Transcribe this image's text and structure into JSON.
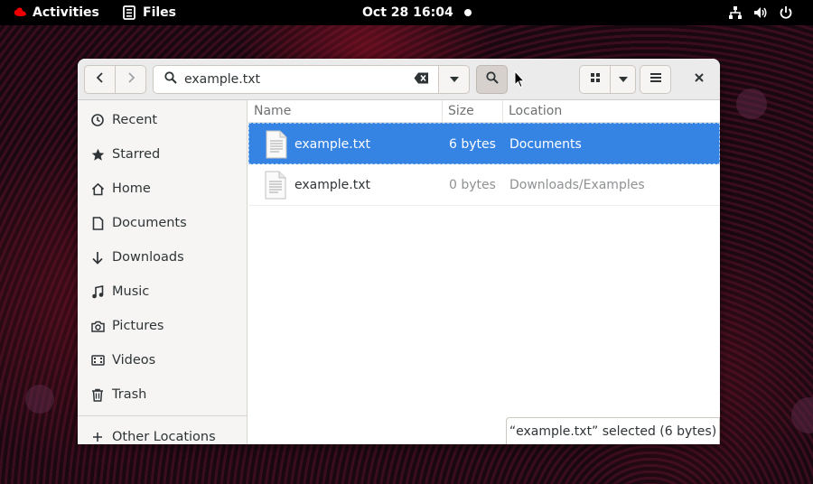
{
  "topbar": {
    "activities": "Activities",
    "app_name": "Files",
    "datetime": "Oct 28  16:04"
  },
  "headerbar": {
    "search_value": "example.txt"
  },
  "sidebar": {
    "items": [
      {
        "label": "Recent",
        "icon": "clock-icon"
      },
      {
        "label": "Starred",
        "icon": "star-icon"
      },
      {
        "label": "Home",
        "icon": "home-icon"
      },
      {
        "label": "Documents",
        "icon": "document-icon"
      },
      {
        "label": "Downloads",
        "icon": "download-icon"
      },
      {
        "label": "Music",
        "icon": "music-icon"
      },
      {
        "label": "Pictures",
        "icon": "camera-icon"
      },
      {
        "label": "Videos",
        "icon": "video-icon"
      },
      {
        "label": "Trash",
        "icon": "trash-icon"
      }
    ],
    "other_locations": "Other Locations"
  },
  "file_list": {
    "columns": [
      "Name",
      "Size",
      "Location"
    ],
    "rows": [
      {
        "name": "example.txt",
        "size": "6 bytes",
        "location": "Documents",
        "selected": true
      },
      {
        "name": "example.txt",
        "size": "0 bytes",
        "location": "Downloads/Examples",
        "selected": false
      }
    ]
  },
  "status": "“example.txt” selected  (6 bytes)",
  "colors": {
    "selection": "#3584e4",
    "topbar": "#000000",
    "sidebar_bg": "#f6f5f4"
  }
}
